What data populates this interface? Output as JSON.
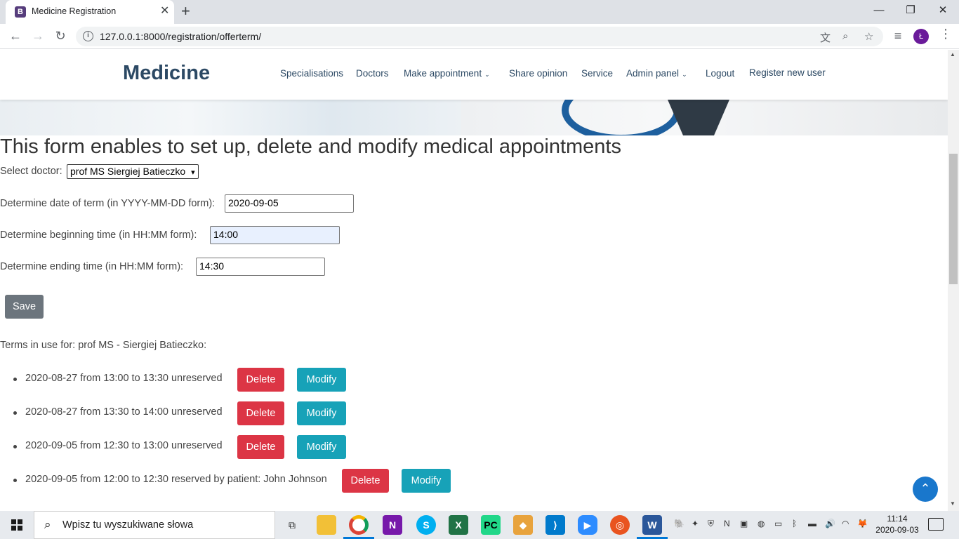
{
  "browser": {
    "tab_title": "Medicine Registration",
    "tab_favicon": "B",
    "tab_close": "✕",
    "new_tab": "+",
    "url": "127.0.0.1:8000/registration/offerterm/",
    "profile_initial": "Ł",
    "window_controls": {
      "minimize": "—",
      "maximize": "❐",
      "close": "✕"
    }
  },
  "site": {
    "brand": "Medicine",
    "nav": [
      {
        "label": "Specialisations",
        "dropdown": false
      },
      {
        "label": "Doctors",
        "dropdown": false
      },
      {
        "label": "Make appointment",
        "dropdown": true
      },
      {
        "label": "Share opinion",
        "dropdown": false
      },
      {
        "label": "Service",
        "dropdown": false
      },
      {
        "label": "Admin panel",
        "dropdown": true
      },
      {
        "label": "Logout",
        "dropdown": false
      },
      {
        "label": "Register new user",
        "dropdown": false
      }
    ],
    "caret": "⌄"
  },
  "form": {
    "heading": "This form enables to set up, delete and modify medical appointments",
    "doctor_label": "Select doctor:",
    "doctor_selected": "prof MS Siergiej Batieczko",
    "date_label": "Determine date of term (in YYYY-MM-DD form):",
    "date_value": "2020-09-05",
    "begin_label": "Determine beginning time (in HH:MM form):",
    "begin_value": "14:00",
    "end_label": "Determine ending time (in HH:MM form):",
    "end_value": "14:30",
    "save_label": "Save"
  },
  "terms": {
    "title": "Terms in use for: prof MS - Siergiej Batieczko:",
    "delete_label": "Delete",
    "modify_label": "Modify",
    "items": [
      {
        "text": "2020-08-27 from 13:00 to 13:30 unreserved"
      },
      {
        "text": "2020-08-27 from 13:30 to 14:00 unreserved"
      },
      {
        "text": "2020-09-05 from 12:30 to 13:00 unreserved"
      },
      {
        "text": "2020-09-05 from 12:00 to 12:30 reserved by patient: John Johnson"
      }
    ]
  },
  "taskbar": {
    "search_placeholder": "Wpisz tu wyszukiwane słowa",
    "time": "11:14",
    "date": "2020-09-03"
  },
  "colors": {
    "brand": "#2c4964",
    "delete": "#dc3545",
    "modify": "#17a2b8",
    "save": "#6c757d",
    "back_to_top": "#1977cc"
  }
}
